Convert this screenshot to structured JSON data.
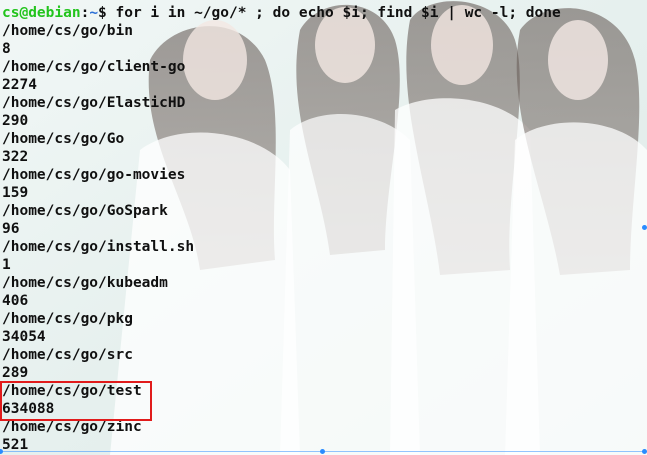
{
  "terminal": {
    "prompt_user": "cs@debian",
    "prompt_sep": ":",
    "prompt_path": "~",
    "prompt_symbol": "$",
    "command": " for i in ~/go/* ; do echo $i; find $i | wc -l; done",
    "output": [
      "/home/cs/go/bin",
      "8",
      "/home/cs/go/client-go",
      "2274",
      "/home/cs/go/ElasticHD",
      "290",
      "/home/cs/go/Go",
      "322",
      "/home/cs/go/go-movies",
      "159",
      "/home/cs/go/GoSpark",
      "96",
      "/home/cs/go/install.sh",
      "1",
      "/home/cs/go/kubeadm",
      "406",
      "/home/cs/go/pkg",
      "34054",
      "/home/cs/go/src",
      "289",
      "/home/cs/go/test",
      "634088",
      "/home/cs/go/zinc",
      "521"
    ]
  },
  "colors": {
    "prompt_user": "#22c41d",
    "prompt_path": "#2a6fd6",
    "text": "#101010",
    "highlight": "#e11b1b"
  }
}
